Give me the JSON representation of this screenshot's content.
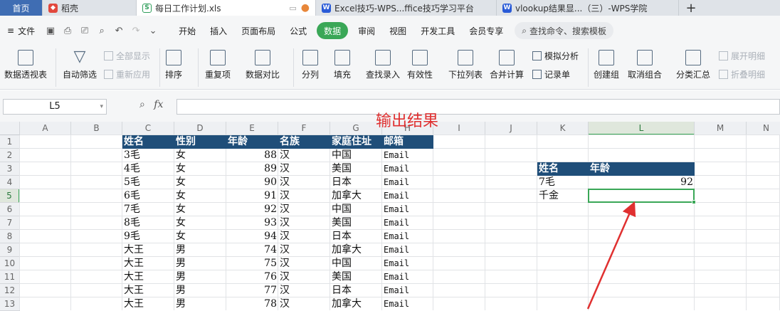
{
  "tabs": [
    {
      "label": "首页",
      "kind": "home"
    },
    {
      "label": "稻壳",
      "icon": "daoke"
    },
    {
      "label": "每日工作计划.xls",
      "icon": "sheet",
      "active": true
    },
    {
      "label": "Excel技巧-WPS...ffice技巧学习平台",
      "icon": "wps"
    },
    {
      "label": "vlookup结果显...（三）-WPS学院",
      "icon": "wps"
    }
  ],
  "menu": {
    "file": "文件",
    "items": [
      "开始",
      "插入",
      "页面布局",
      "公式",
      "数据",
      "审阅",
      "视图",
      "开发工具",
      "会员专享"
    ],
    "active": "数据",
    "search": "查找命令、搜索模板"
  },
  "ribbon": {
    "pivot": "数据透视表",
    "autofilter": "自动筛选",
    "show_all": "全部显示",
    "reapply": "重新应用",
    "sort": "排序",
    "duplicates": "重复项",
    "compare": "数据对比",
    "split": "分列",
    "fill": "填充",
    "lookup_entry": "查找录入",
    "validity": "有效性",
    "dropdown": "下拉列表",
    "consolidate": "合并计算",
    "whatif": "模拟分析",
    "record": "记录单",
    "group": "创建组",
    "ungroup": "取消组合",
    "subtotal": "分类汇总",
    "expand": "展开明细",
    "collapse": "折叠明细"
  },
  "namebox": "L5",
  "fx": "fx",
  "annotation": "输出结果",
  "columns": [
    "A",
    "B",
    "C",
    "D",
    "E",
    "F",
    "G",
    "H",
    "I",
    "J",
    "K",
    "L",
    "M",
    "N"
  ],
  "rows": [
    "1",
    "2",
    "3",
    "4",
    "5",
    "6",
    "7",
    "8",
    "9",
    "10",
    "11",
    "12",
    "13"
  ],
  "table": {
    "headers": [
      "姓名",
      "性别",
      "年龄",
      "名族",
      "家庭住址",
      "邮箱"
    ],
    "rows": [
      [
        "3毛",
        "女",
        "88",
        "汉",
        "中国",
        "Email"
      ],
      [
        "4毛",
        "女",
        "89",
        "汉",
        "美国",
        "Email"
      ],
      [
        "5毛",
        "女",
        "90",
        "汉",
        "日本",
        "Email"
      ],
      [
        "6毛",
        "女",
        "91",
        "汉",
        "加拿大",
        "Email"
      ],
      [
        "7毛",
        "女",
        "92",
        "汉",
        "中国",
        "Email"
      ],
      [
        "8毛",
        "女",
        "93",
        "汉",
        "美国",
        "Email"
      ],
      [
        "9毛",
        "女",
        "94",
        "汉",
        "日本",
        "Email"
      ],
      [
        "大王",
        "男",
        "74",
        "汉",
        "加拿大",
        "Email"
      ],
      [
        "大王",
        "男",
        "75",
        "汉",
        "中国",
        "Email"
      ],
      [
        "大王",
        "男",
        "76",
        "汉",
        "美国",
        "Email"
      ],
      [
        "大王",
        "男",
        "77",
        "汉",
        "日本",
        "Email"
      ],
      [
        "大王",
        "男",
        "78",
        "汉",
        "加拿大",
        "Email"
      ]
    ]
  },
  "lookup": {
    "headers": [
      "姓名",
      "年龄"
    ],
    "rows": [
      [
        "7毛",
        "92"
      ],
      [
        "千金",
        ""
      ]
    ]
  },
  "colors": {
    "header_bg": "#1f4e79",
    "accent": "#3aa757",
    "annotation": "#e03030"
  }
}
